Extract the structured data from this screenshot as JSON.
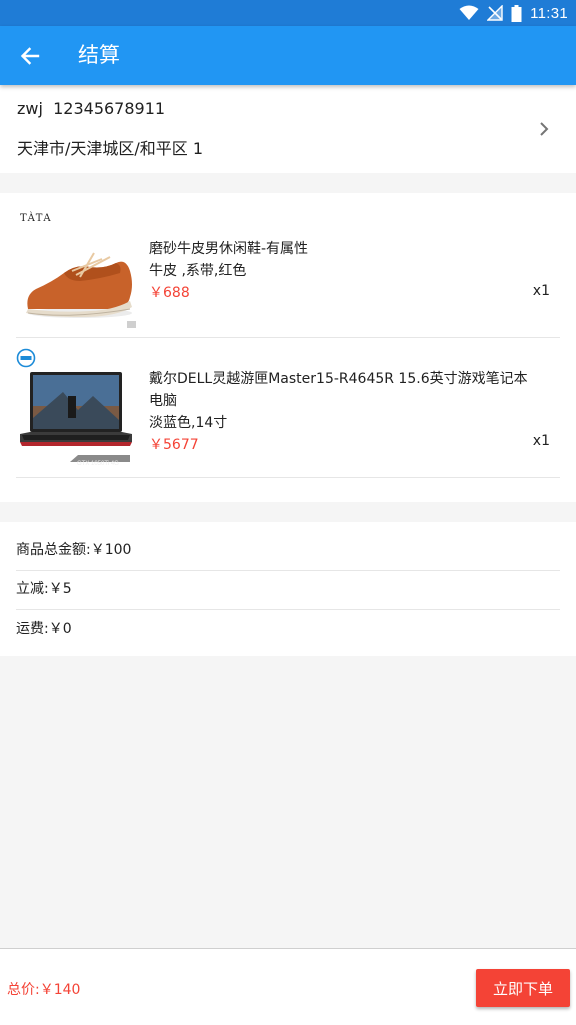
{
  "status_bar": {
    "time": "11:31",
    "icons": [
      "wifi-icon",
      "no-signal-icon",
      "battery-icon"
    ]
  },
  "app_bar": {
    "title": "结算",
    "back_icon": "arrow-left-icon"
  },
  "address": {
    "name_phone": "zwj  12345678911",
    "line": "天津市/天津城区/和平区 1",
    "chevron_icon": "chevron-right-icon"
  },
  "products": [
    {
      "brand": "TÀTA",
      "title": "磨砂牛皮男休闲鞋-有属性",
      "spec": "牛皮 ,系带,红色",
      "price": "￥688",
      "qty": "x1"
    },
    {
      "brand": "DELL",
      "title": "戴尔DELL灵越游匣Master15-R4645R 15.6英寸游戏笔记本电脑",
      "spec": "淡蓝色,14寸",
      "price": "￥5677",
      "qty": "x1",
      "image_caption": "GTX 1050Ti 4G"
    }
  ],
  "summary": {
    "subtotal": "商品总金额:￥100",
    "discount": "立减:￥5",
    "shipping": "运费:￥0"
  },
  "bottom_bar": {
    "total": "总价:￥140",
    "order_label": "立即下单"
  },
  "colors": {
    "status_bar": "#1f7cd6",
    "app_bar": "#2196f3",
    "price": "#f44336",
    "order_button": "#f44336",
    "background": "#f5f5f5"
  }
}
